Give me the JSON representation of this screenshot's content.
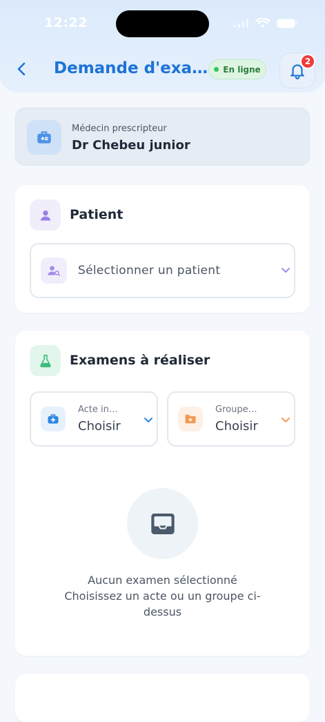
{
  "status_bar": {
    "time": "12:22"
  },
  "header": {
    "title": "Demande d'exa…",
    "online_label": "En ligne",
    "notification_count": "2"
  },
  "doctor": {
    "label": "Médecin prescripteur",
    "name": "Dr Chebeu junior"
  },
  "patient_section": {
    "title": "Patient",
    "select_placeholder": "Sélectionner un patient"
  },
  "exams_section": {
    "title": "Examens à réaliser",
    "acte": {
      "label": "Acte in…",
      "value": "Choisir"
    },
    "groupe": {
      "label": "Groupe…",
      "value": "Choisir"
    },
    "empty": {
      "line1": "Aucun examen sélectionné",
      "line2": "Choisissez un acte ou un groupe ci-",
      "line3": "dessus"
    }
  },
  "colors": {
    "primary": "#1e73d6",
    "online_green": "#34c759",
    "badge_red": "#ef3b3b",
    "patient_purple": "#9b7fe6",
    "exam_green": "#3dbd7d",
    "groupe_orange": "#f29a56"
  },
  "icons": [
    "back-arrow-icon",
    "bell-icon",
    "medical-bag-icon",
    "user-icon",
    "user-search-icon",
    "chevron-down-icon",
    "flask-icon",
    "medical-kit-icon",
    "folder-star-icon",
    "inbox-icon"
  ]
}
